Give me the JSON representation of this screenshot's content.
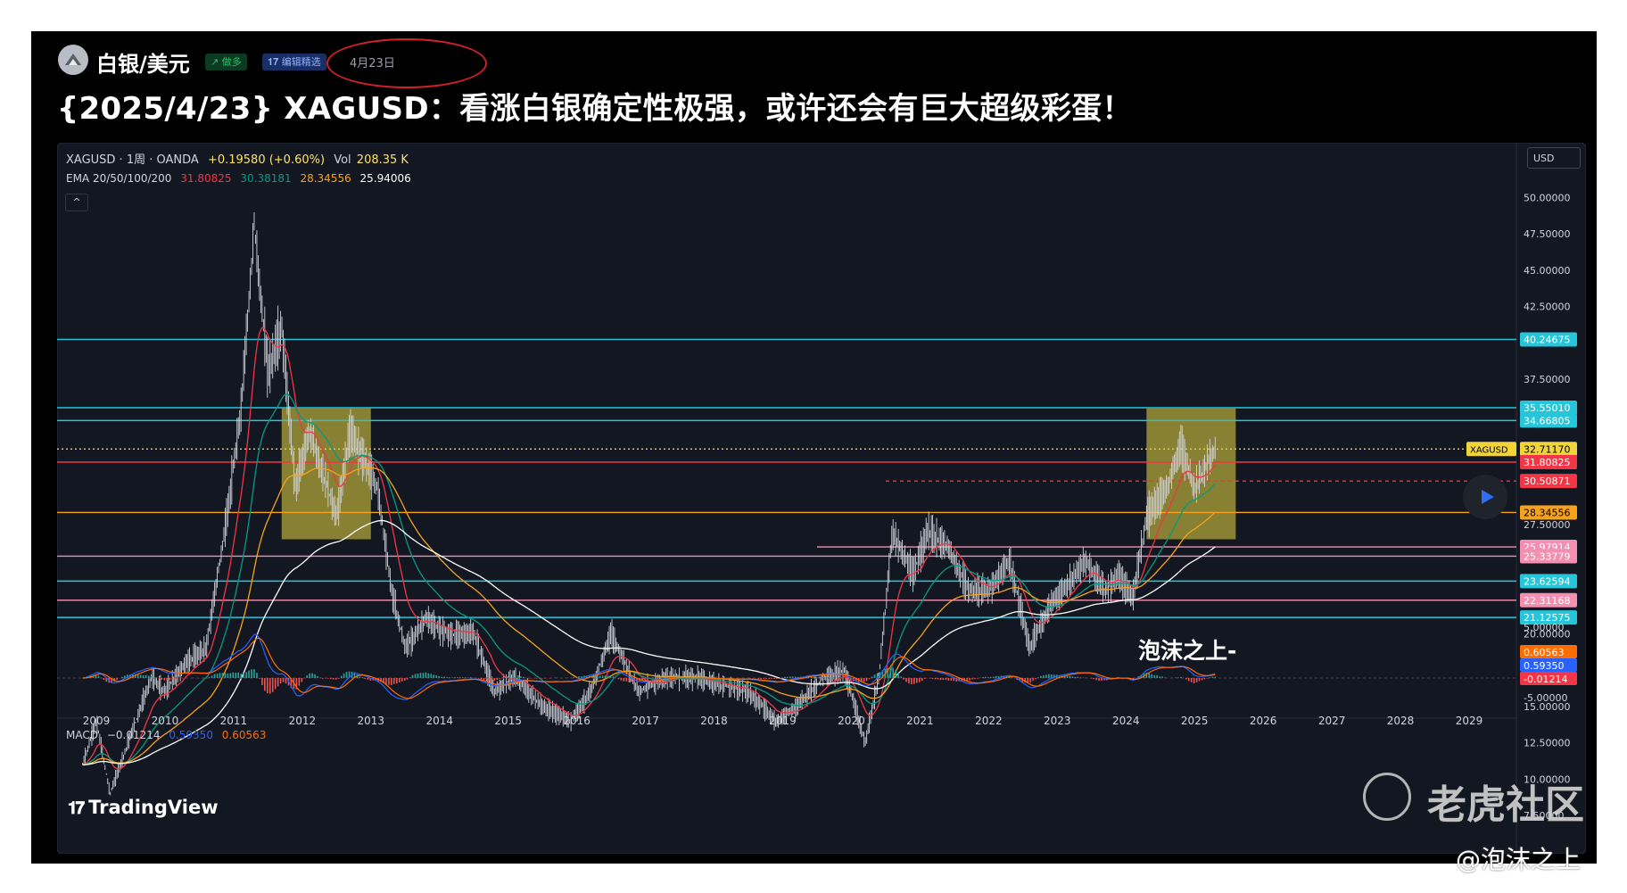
{
  "header": {
    "symbol_name": "白银/美元",
    "badge_long": "↗ 做多",
    "badge_editor": "𝟏𝟕 编辑精选",
    "date": "4月23日",
    "title": "{2025/4/23} XAGUSD：看涨白银确定性极强，或许还会有巨大超级彩蛋！"
  },
  "legend": {
    "symbol": "XAGUSD · 1周 · OANDA",
    "change": "+0.19580 (+0.60%)",
    "vol_label": "Vol",
    "vol_value": "208.35 K",
    "ema_label": "EMA 20/50/100/200",
    "ema20": "31.80825",
    "ema50": "30.38181",
    "ema100": "28.34556",
    "ema200": "25.94006"
  },
  "macd_legend": {
    "label": "MACD",
    "v1": "−0.01214",
    "v2": "0.59350",
    "v3": "0.60563"
  },
  "currency": "USD",
  "collapse_icon": "^",
  "tv_logo": "TradingView",
  "overlay_text": "泡沫之上-",
  "watermark_tiger": "老虎社区",
  "watermark_author": "@泡沫之上",
  "colors": {
    "background": "#131722",
    "ema20": "#f23645",
    "ema50": "#089981",
    "ema100": "#f7a21b",
    "ema200": "#ffffff",
    "hline": "#26c6da",
    "pink": "#f48fb1",
    "box": "#b5a93a",
    "macd_line": "#2962ff",
    "signal_line": "#ff6d00"
  },
  "chart_data": {
    "type": "candlestick",
    "symbol": "XAGUSD",
    "timeframe": "1周",
    "x_ticks": [
      "2009",
      "2010",
      "2011",
      "2012",
      "2013",
      "2014",
      "2015",
      "2016",
      "2017",
      "2018",
      "2019",
      "2020",
      "2021",
      "2022",
      "2023",
      "2024",
      "2025",
      "2026",
      "2027",
      "2028",
      "2029"
    ],
    "y_ticks": [
      "50.00000",
      "47.50000",
      "45.00000",
      "42.50000",
      "37.50000",
      "27.50000",
      "20.00000",
      "17.50000",
      "15.00000",
      "12.50000",
      "10.00000",
      "7.50000",
      "5.00000"
    ],
    "ylim": [
      5,
      52
    ],
    "close_series": [
      {
        "t": 2008.8,
        "v": 11
      },
      {
        "t": 2009.0,
        "v": 14
      },
      {
        "t": 2009.2,
        "v": 9
      },
      {
        "t": 2009.5,
        "v": 13
      },
      {
        "t": 2009.8,
        "v": 17
      },
      {
        "t": 2010.0,
        "v": 16
      },
      {
        "t": 2010.3,
        "v": 18
      },
      {
        "t": 2010.6,
        "v": 19
      },
      {
        "t": 2010.9,
        "v": 28
      },
      {
        "t": 2011.1,
        "v": 35
      },
      {
        "t": 2011.3,
        "v": 48
      },
      {
        "t": 2011.5,
        "v": 38
      },
      {
        "t": 2011.7,
        "v": 41
      },
      {
        "t": 2011.9,
        "v": 30
      },
      {
        "t": 2012.1,
        "v": 34
      },
      {
        "t": 2012.3,
        "v": 31
      },
      {
        "t": 2012.5,
        "v": 28
      },
      {
        "t": 2012.7,
        "v": 34
      },
      {
        "t": 2012.9,
        "v": 32
      },
      {
        "t": 2013.1,
        "v": 30
      },
      {
        "t": 2013.3,
        "v": 23
      },
      {
        "t": 2013.5,
        "v": 19
      },
      {
        "t": 2013.8,
        "v": 21
      },
      {
        "t": 2014.1,
        "v": 20
      },
      {
        "t": 2014.5,
        "v": 20
      },
      {
        "t": 2014.8,
        "v": 16
      },
      {
        "t": 2015.1,
        "v": 17
      },
      {
        "t": 2015.5,
        "v": 15
      },
      {
        "t": 2015.9,
        "v": 14
      },
      {
        "t": 2016.2,
        "v": 16
      },
      {
        "t": 2016.5,
        "v": 20
      },
      {
        "t": 2016.9,
        "v": 16
      },
      {
        "t": 2017.3,
        "v": 17
      },
      {
        "t": 2017.7,
        "v": 17
      },
      {
        "t": 2018.1,
        "v": 16.5
      },
      {
        "t": 2018.5,
        "v": 16
      },
      {
        "t": 2018.9,
        "v": 14
      },
      {
        "t": 2019.2,
        "v": 15
      },
      {
        "t": 2019.6,
        "v": 17
      },
      {
        "t": 2019.9,
        "v": 17.5
      },
      {
        "t": 2020.2,
        "v": 12.5
      },
      {
        "t": 2020.4,
        "v": 17
      },
      {
        "t": 2020.6,
        "v": 27
      },
      {
        "t": 2020.9,
        "v": 24
      },
      {
        "t": 2021.1,
        "v": 27
      },
      {
        "t": 2021.4,
        "v": 26
      },
      {
        "t": 2021.7,
        "v": 23
      },
      {
        "t": 2022.0,
        "v": 23
      },
      {
        "t": 2022.3,
        "v": 25
      },
      {
        "t": 2022.6,
        "v": 19
      },
      {
        "t": 2022.9,
        "v": 22
      },
      {
        "t": 2023.1,
        "v": 23
      },
      {
        "t": 2023.4,
        "v": 25
      },
      {
        "t": 2023.7,
        "v": 23
      },
      {
        "t": 2023.9,
        "v": 24
      },
      {
        "t": 2024.1,
        "v": 22.5
      },
      {
        "t": 2024.3,
        "v": 28
      },
      {
        "t": 2024.6,
        "v": 30
      },
      {
        "t": 2024.8,
        "v": 33
      },
      {
        "t": 2025.0,
        "v": 30
      },
      {
        "t": 2025.3,
        "v": 32.7
      }
    ],
    "horizontal_levels": [
      {
        "value": 40.24675,
        "label": "40.24675",
        "color": "#26c6da"
      },
      {
        "value": 35.5501,
        "label": "35.55010",
        "color": "#26c6da"
      },
      {
        "value": 34.66805,
        "label": "34.66805",
        "color": "#26c6da"
      },
      {
        "value": 32.7117,
        "label": "32.71170",
        "color": "#f0d43a",
        "name": "XAGUSD"
      },
      {
        "value": 31.80825,
        "label": "31.80825",
        "color": "#f23645"
      },
      {
        "value": 30.50871,
        "label": "30.50871",
        "color": "#f23645"
      },
      {
        "value": 28.34556,
        "label": "28.34556",
        "color": "#f7a21b"
      },
      {
        "value": 25.97914,
        "label": "25.97914",
        "color": "#f48fb1"
      },
      {
        "value": 25.33779,
        "label": "25.33779",
        "color": "#f48fb1"
      },
      {
        "value": 23.62594,
        "label": "23.62594",
        "color": "#26c6da"
      },
      {
        "value": 22.31168,
        "label": "22.31168",
        "color": "#f48fb1"
      },
      {
        "value": 21.12575,
        "label": "21.12575",
        "color": "#26c6da"
      }
    ],
    "highlight_boxes": [
      {
        "t0": 2011.7,
        "t1": 2013.0,
        "v0": 26.5,
        "v1": 35.5
      },
      {
        "t0": 2024.3,
        "t1": 2025.6,
        "v0": 26.5,
        "v1": 35.5
      }
    ],
    "macd_panel": {
      "label": "MACD",
      "y_ticks": [
        "5.00000",
        "-5.00000"
      ],
      "price_labels": [
        {
          "label": "0.60563",
          "color": "#ff6d00"
        },
        {
          "label": "0.59350",
          "color": "#2962ff"
        },
        {
          "label": "-0.01214",
          "color": "#f23645"
        }
      ]
    }
  }
}
